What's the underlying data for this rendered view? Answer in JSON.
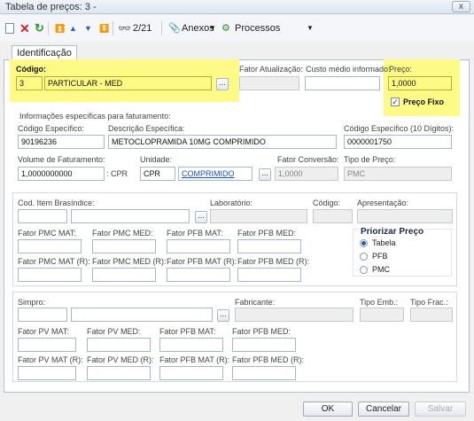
{
  "window": {
    "title": "Tabela de preços: 3 -",
    "close": "x"
  },
  "toolbar": {
    "new_icon": "new-document-icon",
    "delete_icon": "delete-x-icon",
    "refresh_icon": "refresh-icon",
    "first_icon": "first-record-icon",
    "prev_icon": "previous-record-icon",
    "next_icon": "next-record-icon",
    "last_icon": "last-record-icon",
    "find_icon": "binoculars-icon",
    "counter": "2/21",
    "anexos": "Anexos",
    "processos": "Processos"
  },
  "tabs": {
    "identificacao": "Identificação"
  },
  "codigo": {
    "label": "Código:",
    "num": "3",
    "desc": "PARTICULAR - MED",
    "btn": "..."
  },
  "fator_atualizacao": {
    "label": "Fator Atualização:"
  },
  "custo_medio": {
    "label": "Custo médio informado:"
  },
  "preco": {
    "label": "Preço:",
    "value": "1,0000",
    "fixo_label": "Preço Fixo",
    "fixo_check": "✓"
  },
  "faturamento": {
    "section": "Informações específicas para faturamento:",
    "cod_esp_label": "Código Específico:",
    "cod_esp": "90196236",
    "desc_esp_label": "Descrição Específica:",
    "desc_esp": "METOCLOPRAMIDA 10MG COMPRIMIDO",
    "cod10_label": "Código Específico (10 Dígitos):",
    "cod10": "0000001750",
    "volume_label": "Volume de Faturamento:",
    "volume": "1,0000000000",
    "volume_unit": ": CPR",
    "unidade_label": "Unidade:",
    "unidade": "CPR",
    "unidade_link": "COMPRIMIDO",
    "btn": "...",
    "fator_conv_label": "Fator Conversão:",
    "fator_conv": "1,0000",
    "tipo_preco_label": "Tipo de Preço:",
    "tipo_preco": "PMC"
  },
  "brasindice": {
    "cod_label": "Cod. Item Brasíndice:",
    "lab_label": "Laboratório:",
    "codigo_label": "Código:",
    "apres_label": "Apresentação:",
    "btn": "...",
    "pmc_mat": "Fator PMC MAT:",
    "pmc_med": "Fator PMC MED:",
    "pfb_mat": "Fator PFB MAT:",
    "pfb_med": "Fator PFB MED:",
    "pmc_mat_r": "Fator PMC MAT (R):",
    "pmc_med_r": "Fator PMC MED (R):",
    "pfb_mat_r": "Fator PFB MAT (R):",
    "pfb_med_r": "Fator PFB MED (R):"
  },
  "priorizar": {
    "title": "Priorizar Preço",
    "options": [
      "Tabela",
      "PFB",
      "PMC"
    ]
  },
  "simpro": {
    "label": "Simpro:",
    "fab_label": "Fabricante:",
    "tipo_emb": "Tipo Emb.:",
    "tipo_frac": "Tipo Frac.:",
    "btn": "...",
    "pv_mat": "Fator PV MAT:",
    "pv_med": "Fator PV MED:",
    "pfb_mat": "Fator PFB MAT:",
    "pfb_med": "Fator PFB MED:",
    "pv_mat_r": "Fator PV MAT (R):",
    "pv_med_r": "Fator PV MED (R):",
    "pfb_mat_r": "Fator PFB MAT (R):",
    "pfb_med_r": "Fator PFB MED (R):"
  },
  "footer": {
    "ok": "OK",
    "cancel": "Cancelar",
    "save": "Salvar"
  }
}
